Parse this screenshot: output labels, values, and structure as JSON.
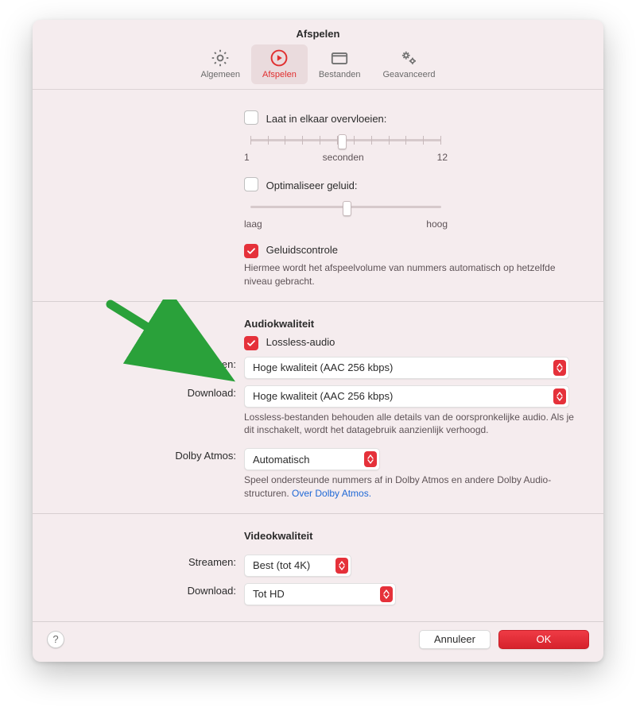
{
  "title": "Afspelen",
  "tabs": [
    {
      "label": "Algemeen"
    },
    {
      "label": "Afspelen"
    },
    {
      "label": "Bestanden"
    },
    {
      "label": "Geavanceerd"
    }
  ],
  "crossfade": {
    "label": "Laat in elkaar overvloeien:",
    "min_label": "1",
    "mid_label": "seconden",
    "max_label": "12"
  },
  "optimize": {
    "label": "Optimaliseer geluid:",
    "low": "laag",
    "high": "hoog"
  },
  "soundcheck": {
    "label": "Geluidscontrole",
    "help": "Hiermee wordt het afspeelvolume van nummers automatisch op hetzelfde niveau gebracht."
  },
  "audio_quality": {
    "heading": "Audiokwaliteit",
    "lossless_label": "Lossless-audio",
    "stream_label": "Streamen:",
    "stream_value": "Hoge kwaliteit (AAC 256 kbps)",
    "download_label": "Download:",
    "download_value": "Hoge kwaliteit (AAC 256 kbps)",
    "help": "Lossless-bestanden behouden alle details van de oorspronkelijke audio. Als je dit inschakelt, wordt het datagebruik aanzienlijk verhoogd."
  },
  "dolby": {
    "label": "Dolby Atmos:",
    "value": "Automatisch",
    "help_pre": "Speel ondersteunde nummers af in Dolby Atmos en andere Dolby Audio-structuren. ",
    "link": "Over Dolby Atmos."
  },
  "video_quality": {
    "heading": "Videokwaliteit",
    "stream_label": "Streamen:",
    "stream_value": "Best (tot 4K)",
    "download_label": "Download:",
    "download_value": "Tot HD"
  },
  "footer": {
    "cancel": "Annuleer",
    "ok": "OK"
  }
}
